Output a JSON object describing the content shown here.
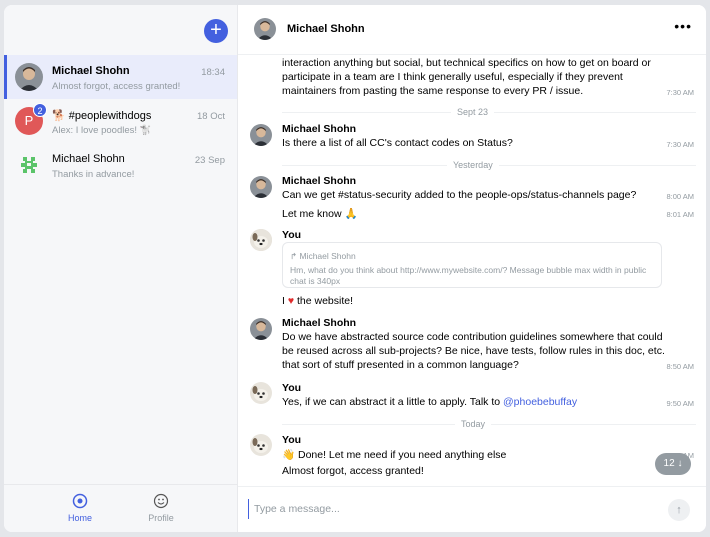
{
  "sidebar": {
    "new_chat_icon": "plus-icon",
    "chats": [
      {
        "name": "Michael Shohn",
        "preview": "Almost forgot, access granted!",
        "time": "18:34",
        "active": true
      },
      {
        "name": "🐕 #peoplewithdogs",
        "preview": "Alex: I love poodles! 🐩",
        "time": "18 Oct",
        "avatar_letter": "P",
        "unread": "2",
        "avatar_color": "#e05858"
      },
      {
        "name": "Michael Shohn",
        "preview": "Thanks in advance!",
        "time": "23 Sep",
        "avatar_color": "#5bc46a"
      }
    ],
    "nav": [
      {
        "label": "Home",
        "icon": "home-icon",
        "active": true
      },
      {
        "label": "Profile",
        "icon": "profile-smile-icon",
        "active": false
      }
    ]
  },
  "header": {
    "title": "Michael Shohn",
    "more_icon": "more-dots-icon"
  },
  "messages": {
    "top_lines": [
      "interaction anything but social, but technical specifics on how to get on board or",
      "participate in a team are I think generally useful, especially if they prevent",
      "maintainers from pasting the same response to every PR / issue."
    ],
    "top_time": "7:30 AM",
    "divider_1": "Sept 23",
    "m1_author": "Michael Shohn",
    "m1_text": "Is there a list of all CC's contact codes on Status?",
    "m1_time": "7:30 AM",
    "divider_2": "Yesterday",
    "m2_author": "Michael Shohn",
    "m2_text": "Can we get #status-security added to the people-ops/status-channels page?",
    "m2_time": "8:00 AM",
    "m2b_text": "Let me know 🙏",
    "m2b_time": "8:01 AM",
    "m3_author": "You",
    "reply_author": "Michael Shohn",
    "reply_text": "Hm, what do you think about http://www.mywebsite.com/? Message bubble max width in public chat is 340px",
    "m3_text_pre": "I",
    "m3_text_post": "the website!",
    "m4_author": "Michael Shohn",
    "m4_lines": [
      "Do we have abstracted source code contribution guidelines somewhere that could",
      "be reused across all sub-projects? Be nice, have tests, follow rules in this doc, etc.",
      "that sort of stuff presented in a common language?"
    ],
    "m4_time": "8:50 AM",
    "m5_author": "You",
    "m5_text": "Yes, if we can abstract it a little to apply. Talk to ",
    "m5_mention": "@phoebebuffay",
    "m5_time": "9:50 AM",
    "divider_3": "Today",
    "m6_author": "You",
    "m6_text": "👋 Done! Let me need if you need anything else",
    "m6_time": "9:50 AM",
    "m6b_text": "Almost forgot, access granted!",
    "jump_count": "12 ↓"
  },
  "composer": {
    "placeholder": "Type a message...",
    "send_icon": "arrow-up-icon"
  },
  "colors": {
    "accent": "#4360df",
    "muted": "#939ba1",
    "heart": "#e02b2b"
  }
}
